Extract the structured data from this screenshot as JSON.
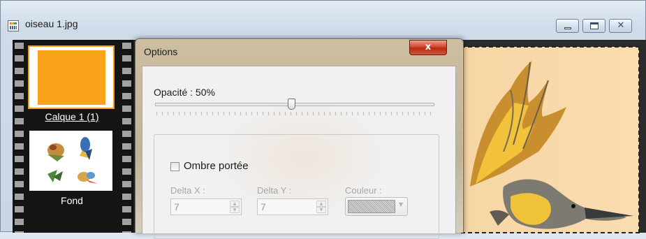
{
  "window": {
    "title": "oiseau 1.jpg",
    "icon": "image-file-icon",
    "controls": {
      "minimize": "minimize-icon",
      "maximize": "maximize-icon",
      "close": "close-icon"
    }
  },
  "layers": [
    {
      "label": "Calque 1 (1)",
      "selected": true,
      "color": "#f9a31b"
    },
    {
      "label": "Fond",
      "selected": false
    }
  ],
  "dialog": {
    "title": "Options",
    "close_glyph": "x",
    "opacity": {
      "label": "Opacité : 50%",
      "value": 50
    },
    "drop_shadow": {
      "checkbox_label": "Ombre portée",
      "checked": false,
      "delta_x": {
        "label": "Delta X :",
        "value": "7"
      },
      "delta_y": {
        "label": "Delta Y :",
        "value": "7"
      },
      "color": {
        "label": "Couleur :"
      }
    }
  },
  "colors": {
    "accent": "#f9a31b",
    "canvas_bg": "#fbdcaf",
    "filmstrip": "#141414"
  }
}
